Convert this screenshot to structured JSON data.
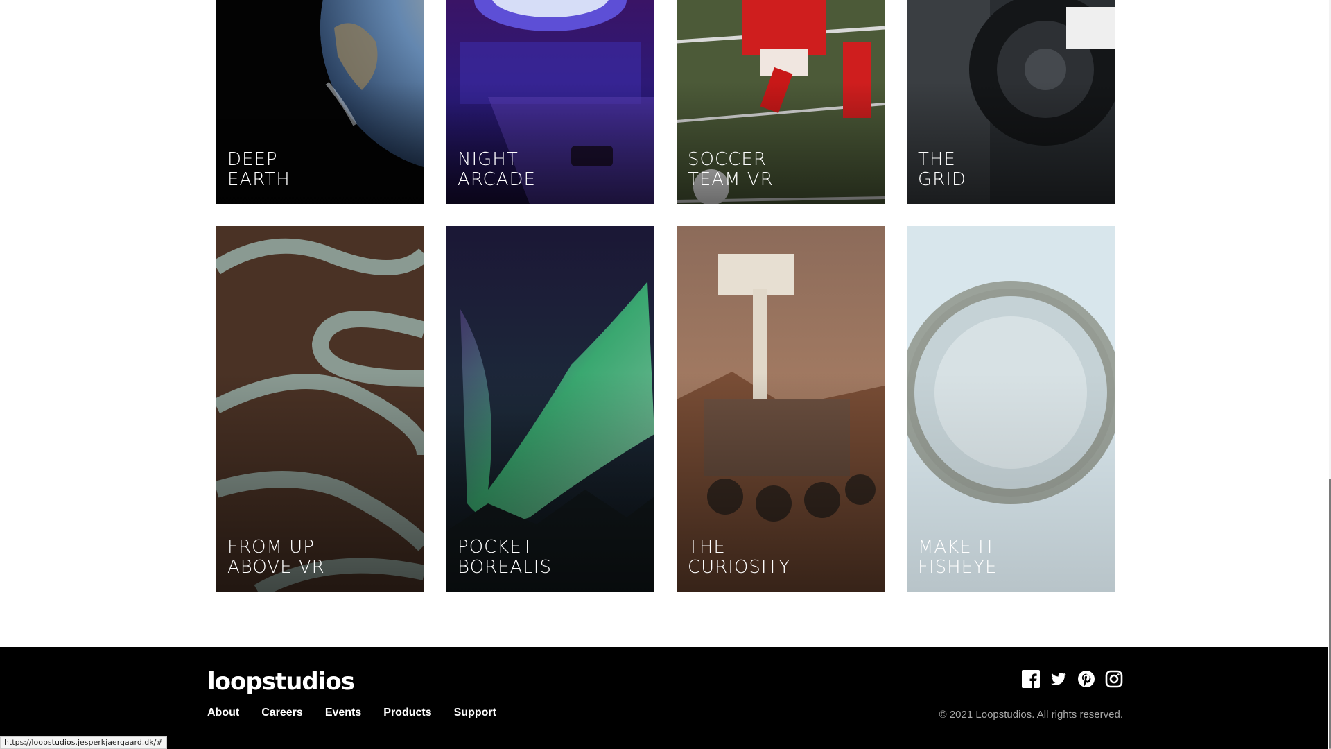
{
  "gallery": {
    "row1": [
      {
        "line1": "DEEP",
        "line2": "EARTH"
      },
      {
        "line1": "NIGHT",
        "line2": "ARCADE"
      },
      {
        "line1": "SOCCER",
        "line2": "TEAM VR"
      },
      {
        "line1": "THE",
        "line2": "GRID"
      }
    ],
    "row2": [
      {
        "line1": "FROM UP",
        "line2": "ABOVE VR"
      },
      {
        "line1": "POCKET",
        "line2": "BOREALIS"
      },
      {
        "line1": "THE",
        "line2": "CURIOSITY"
      },
      {
        "line1": "MAKE IT",
        "line2": "FISHEYE"
      }
    ]
  },
  "footer": {
    "logo": "loopstudios",
    "nav": [
      "About",
      "Careers",
      "Events",
      "Products",
      "Support"
    ],
    "socials": [
      "facebook-icon",
      "twitter-icon",
      "pinterest-icon",
      "instagram-icon"
    ],
    "copyright": "© 2021 Loopstudios. All rights reserved."
  },
  "status_bar": {
    "url": "https://loopstudios.jesperkjaergaard.dk/#"
  }
}
